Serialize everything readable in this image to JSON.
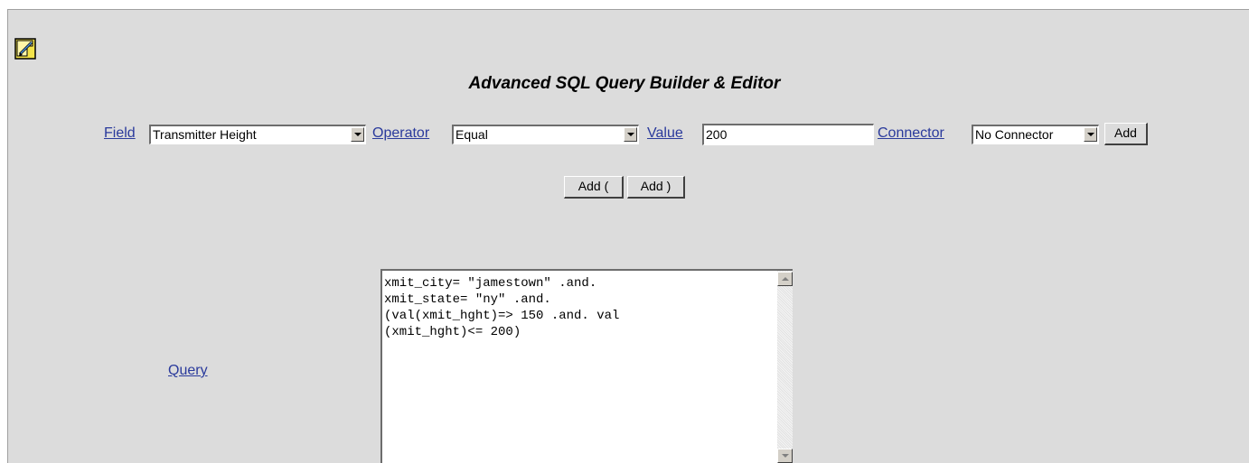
{
  "app": {
    "title": "Advanced SQL Query Builder & Editor",
    "icon": "document-edit-icon"
  },
  "builder": {
    "field_label": "Field",
    "field_value": "Transmitter Height",
    "operator_label": "Operator",
    "operator_value": "Equal",
    "value_label": "Value",
    "value_input": "200",
    "connector_label": "Connector",
    "connector_value": "No Connector",
    "add_label": "Add",
    "add_open_paren_label": "Add (",
    "add_close_paren_label": "Add )"
  },
  "query": {
    "label": "Query",
    "text": "xmit_city= \"jamestown\" .and.\nxmit_state= \"ny\" .and.\n(val(xmit_hght)=> 150 .and. val\n(xmit_hght)<= 200)"
  },
  "colors": {
    "panel_bg": "#dcdcdc",
    "link": "#2a3a9c"
  }
}
